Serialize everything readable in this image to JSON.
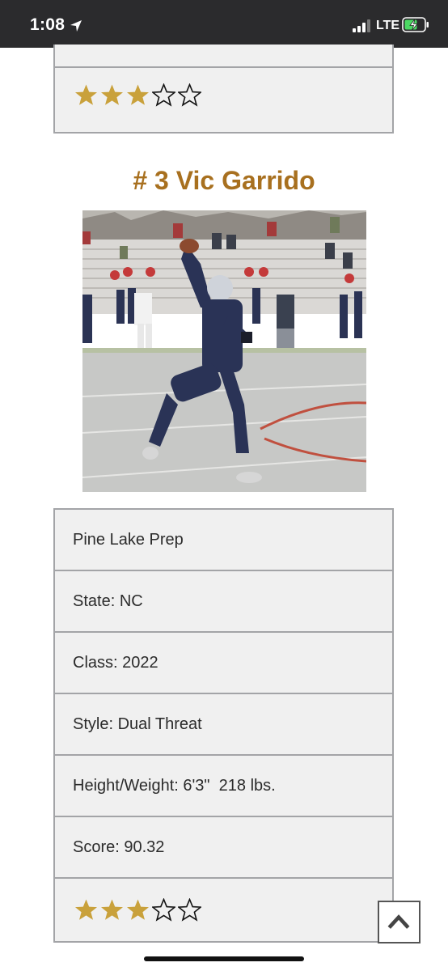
{
  "status_bar": {
    "time": "1:08",
    "network": "LTE",
    "location_icon": "location-arrow-icon",
    "signal_icon": "cellular-signal-icon",
    "battery_icon": "battery-charging-icon"
  },
  "previous_player": {
    "rating": {
      "filled": 3,
      "total": 5
    }
  },
  "player": {
    "title": "# 3 Vic Garrido",
    "photo_alt": "football-player-photo",
    "school": "Pine Lake Prep",
    "state": "State: NC",
    "class": "Class: 2022",
    "style": "Style: Dual Threat",
    "height_weight": "Height/Weight: 6'3\"  218 lbs.",
    "score": "Score: 90.32",
    "rating": {
      "filled": 3,
      "total": 5
    }
  },
  "colors": {
    "title": "#a8701f",
    "star_filled": "#c9a13b",
    "card_bg": "#f0f0f0",
    "card_border": "#a3a4a7",
    "status_bar": "#2b2b2d"
  },
  "scroll_top": {
    "icon": "chevron-up-icon"
  }
}
